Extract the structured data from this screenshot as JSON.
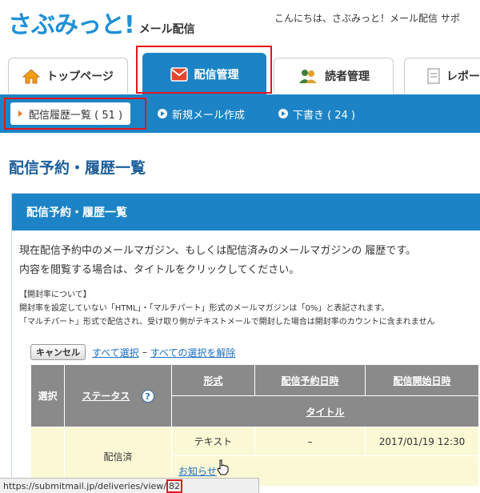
{
  "header": {
    "logo_main": "さぶみっと!",
    "logo_sub": "メール配信",
    "greeting": "こんにちは、さぶみっと！メール配信 サポ"
  },
  "tabs": [
    {
      "label": "トップページ",
      "icon": "home-icon"
    },
    {
      "label": "配信管理",
      "icon": "mail-icon",
      "active": true
    },
    {
      "label": "読者管理",
      "icon": "users-icon"
    },
    {
      "label": "レポー",
      "icon": "report-icon"
    }
  ],
  "subnav": [
    {
      "label": "配信履歴一覧 ( 51 )",
      "current": true
    },
    {
      "label": "新規メール作成"
    },
    {
      "label": "下書き ( 24 )"
    }
  ],
  "page_title": "配信予約・履歴一覧",
  "panel": {
    "title": "配信予約・履歴一覧",
    "desc_line1": "現在配信予約中のメールマガジン、もしくは配信済みのメールマガジンの 履歴です。",
    "desc_line2": "内容を閲覧する場合は、タイトルをクリックしてください。",
    "note_head": "【開封率について】",
    "note_line1": "開封率を設定していない「HTML」・「マルチパート」形式のメールマガジンは「0%」と表記されます。",
    "note_line2": "「マルチパート」形式で配信され、受け取り側がテキストメールで開封した場合は開封率のカウントに含まれません"
  },
  "actions": {
    "cancel_button": "キャンセル",
    "select_all": "すべて選択",
    "separator": "–",
    "clear_all": "すべての選択を解除"
  },
  "table": {
    "col_select": "選択",
    "col_status": "ステータス",
    "help": "?",
    "col_format": "形式",
    "col_reserved": "配信予約日時",
    "col_start": "配信開始日時",
    "col_title": "タイトル",
    "row": {
      "status": "配信済",
      "format": "テキスト",
      "reserved": "–",
      "start": "2017/01/19 12:30",
      "title": "お知らせ"
    }
  },
  "statusbar": {
    "url_prefix": "https://submitmail.jp/deliveries/view/",
    "url_id": "82"
  },
  "colors": {
    "accent": "#1c84c6",
    "highlight": "#e0161d"
  }
}
